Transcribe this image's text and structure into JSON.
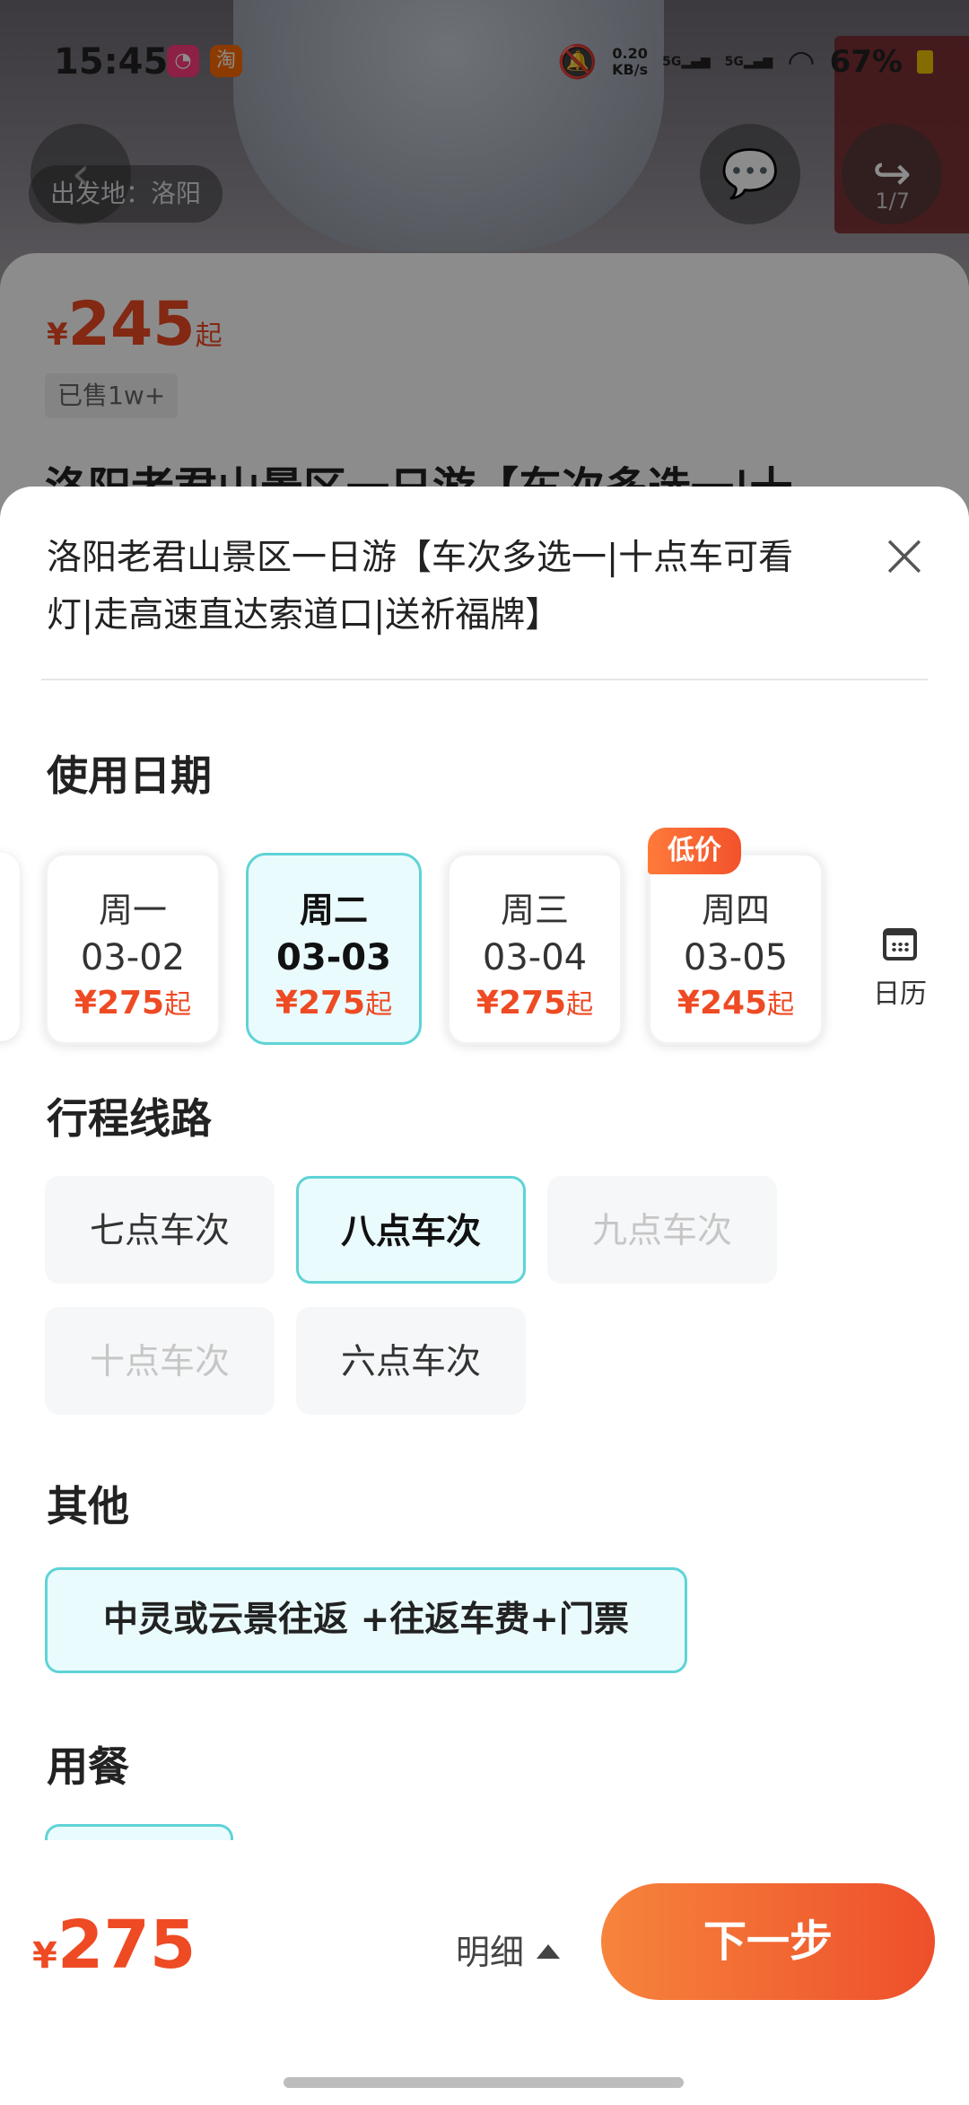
{
  "status_bar": {
    "time": "15:45",
    "app1": "◔",
    "app2": "淘",
    "net_speed_value": "0.20",
    "net_speed_unit": "KB/s",
    "sig1": "5G",
    "sig2": "5G",
    "battery": "67%"
  },
  "background": {
    "origin_tag": "出发地：洛阳",
    "page_indicator": "1/7",
    "price_currency": "¥",
    "price_value": "245",
    "price_suffix": "起",
    "sold": "已售1w+",
    "title_partial": "洛阳老君山景区一日游【车次多选一|十"
  },
  "sheet": {
    "title": "洛阳老君山景区一日游【车次多选一|十点车可看灯|走高速直达索道口|送祈福牌】",
    "date_section": "使用日期",
    "dates": [
      {
        "weekday": "周一",
        "date": "03-02",
        "price": "¥275",
        "suffix": "起",
        "selected": false
      },
      {
        "weekday": "周二",
        "date": "03-03",
        "price": "¥275",
        "suffix": "起",
        "selected": true
      },
      {
        "weekday": "周三",
        "date": "03-04",
        "price": "¥275",
        "suffix": "起",
        "selected": false
      },
      {
        "weekday": "周四",
        "date": "03-05",
        "price": "¥245",
        "suffix": "起",
        "selected": false
      }
    ],
    "low_price_badge": "低价",
    "calendar_label": "日历",
    "route_section": "行程线路",
    "routes": [
      {
        "label": "七点车次",
        "state": "normal"
      },
      {
        "label": "八点车次",
        "state": "selected"
      },
      {
        "label": "九点车次",
        "state": "disabled"
      },
      {
        "label": "十点车次",
        "state": "disabled"
      },
      {
        "label": "六点车次",
        "state": "normal"
      }
    ],
    "other_section": "其他",
    "other_option": "中灵或云景往返 +往返车费+门票",
    "meal_section": "用餐"
  },
  "bottom_bar": {
    "currency": "¥",
    "total": "275",
    "detail_label": "明细",
    "next_label": "下一步"
  },
  "colors": {
    "accent": "#ee4a23",
    "selected_border": "#5fd3d6",
    "selected_bg": "#e9fbfc"
  }
}
